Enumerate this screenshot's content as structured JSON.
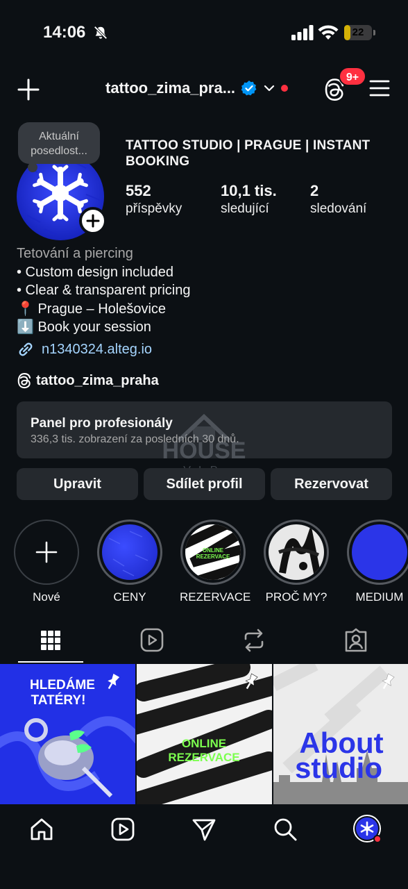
{
  "status_bar": {
    "time": "14:06",
    "battery": "22",
    "battery_level": 0.22
  },
  "header": {
    "username": "tattoo_zima_pra...",
    "notifications_badge": "9+"
  },
  "profile": {
    "note": "Aktuální posedlost...",
    "display_name": "TATTOO STUDIO | PRAGUE | INSTANT BOOKING",
    "stats": [
      {
        "value": "552",
        "label": "příspěvky"
      },
      {
        "value": "10,1 tis.",
        "label": "sledující"
      },
      {
        "value": "2",
        "label": "sledování"
      }
    ],
    "category": "Tetování a piercing",
    "bio_lines": [
      "• Custom design included",
      "• Clear & transparent pricing",
      "📍 Prague – Holešovice",
      "⬇️ Book your session"
    ],
    "link": "n1340324.alteg.io",
    "threads_handle": "tattoo_zima_praha"
  },
  "pro_panel": {
    "title": "Panel pro profesionály",
    "subtitle": "336,3 tis. zobrazení za posledních 30 dnů."
  },
  "watermark": {
    "line1": "HOUSE",
    "line2": "V.I.P."
  },
  "buttons": {
    "edit": "Upravit",
    "share": "Sdílet profil",
    "book": "Rezervovat"
  },
  "highlights": [
    {
      "label": "Nové"
    },
    {
      "label": "CENY"
    },
    {
      "label": "REZERVACE",
      "cover_text_1": "ONLINE",
      "cover_text_2": "REZERVACE"
    },
    {
      "label": "PROČ MY?"
    },
    {
      "label": "MEDIUM"
    }
  ],
  "posts": [
    {
      "text_1": "HLEDÁME",
      "text_2": "TATÉRY!"
    },
    {
      "text_1": "ONLINE",
      "text_2": "REZERVACE"
    },
    {
      "text_1": "About",
      "text_2": "studio"
    }
  ],
  "colors": {
    "background": "#0c1014",
    "card": "#25292e",
    "accent_red": "#ff3040",
    "verified_blue": "#0095f6",
    "brand_blue": "#2b35e8",
    "lime": "#7cff4f"
  }
}
